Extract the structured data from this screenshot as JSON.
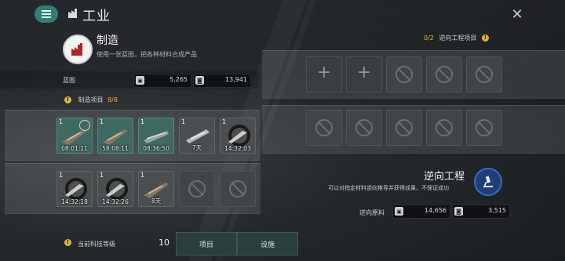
{
  "header": {
    "title": "工业",
    "menu_icon": "menu-icon",
    "close_icon": "close-icon",
    "section_icon": "factory-icon"
  },
  "craft": {
    "title": "制造",
    "desc": "使用一张蓝图，把各种材料合成产品",
    "icon": "factory-icon"
  },
  "blueprint": {
    "label": "蓝图",
    "resource1": {
      "icon": "blueprint-a-icon",
      "value": "5,265"
    },
    "resource2": {
      "icon": "blueprint-b-icon",
      "value": "13,941"
    }
  },
  "projects": {
    "label": "制造项目",
    "count": "8/8",
    "slots_row1": [
      {
        "qty": "1",
        "time": "08:01:11",
        "style": "filled",
        "icon": "cruiser-ship-icon"
      },
      {
        "qty": "1",
        "time": "58:08:11",
        "style": "filled",
        "icon": "cruiser-ship-icon"
      },
      {
        "qty": "1",
        "time": "08:36:50",
        "style": "filled",
        "icon": "destroyer-ship-icon"
      },
      {
        "qty": "1",
        "time": "7天",
        "style": "filled-dark",
        "icon": "frigate-ship-icon"
      },
      {
        "qty": "1",
        "time": "14:32:03",
        "style": "filled-dark",
        "icon": "fighter-ship-icon"
      }
    ],
    "slots_row2": [
      {
        "qty": "1",
        "time": "14:32:18",
        "style": "filled-dark",
        "icon": "fighter-ship-icon"
      },
      {
        "qty": "1",
        "time": "14:32:26",
        "style": "filled-dark",
        "icon": "fighter-ship-icon"
      },
      {
        "qty": "1",
        "time": "8天",
        "style": "filled-dark",
        "icon": "cruiser-ship-icon"
      }
    ]
  },
  "tech": {
    "label": "当前科技等级",
    "value": "10",
    "tab1": "项目",
    "tab2": "设施"
  },
  "reverse": {
    "header_label": "逆向工程项目",
    "header_count": "0/2",
    "title": "逆向工程",
    "desc": "可以对指定材料逆向推导并获得成果，不保证成功",
    "icon": "microscope-icon",
    "res_label": "逆向原料",
    "res1": {
      "icon": "blueprint-a-icon",
      "value": "14,656"
    },
    "res2": {
      "icon": "blueprint-b-icon",
      "value": "3,515"
    }
  },
  "colors": {
    "accent": "#2e7f74",
    "warning": "#e0b43a",
    "reverse_icon": "#1e3f7a"
  }
}
